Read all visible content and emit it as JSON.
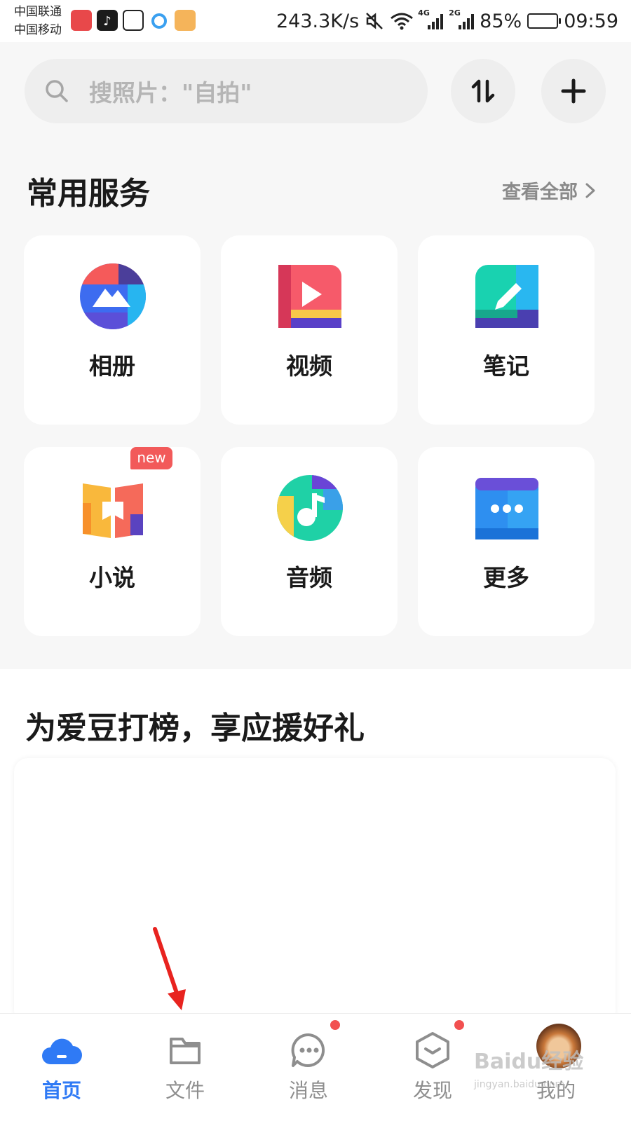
{
  "status_bar": {
    "carrier_1": "中国联通",
    "carrier_2": "中国移动",
    "net_speed": "243.3K/s",
    "signal_1_type": "4G",
    "signal_2_type": "2G",
    "battery": "85%",
    "battery_level": 0.85,
    "time": "09:59"
  },
  "search": {
    "placeholder": "搜照片：\"自拍\""
  },
  "services": {
    "title": "常用服务",
    "view_all": "查看全部",
    "items": [
      {
        "label": "相册",
        "icon": "album-icon"
      },
      {
        "label": "视频",
        "icon": "video-icon"
      },
      {
        "label": "笔记",
        "icon": "note-icon"
      },
      {
        "label": "小说",
        "icon": "novel-icon",
        "badge": "new"
      },
      {
        "label": "音频",
        "icon": "audio-icon"
      },
      {
        "label": "更多",
        "icon": "more-icon"
      }
    ]
  },
  "promo": {
    "title": "为爱豆打榜，享应援好礼"
  },
  "bottom_nav": {
    "items": [
      {
        "label": "首页",
        "icon": "cloud-home-icon",
        "active": true
      },
      {
        "label": "文件",
        "icon": "folder-icon"
      },
      {
        "label": "消息",
        "icon": "message-icon",
        "dot": true
      },
      {
        "label": "发现",
        "icon": "discover-icon",
        "dot": true
      },
      {
        "label": "我的",
        "icon": "avatar"
      }
    ]
  },
  "watermark": {
    "main": "Baidu经验",
    "sub": "jingyan.baidu.com"
  },
  "colors": {
    "accent": "#2f7af5",
    "badge_red": "#f25a5a",
    "background": "#f7f7f7"
  }
}
